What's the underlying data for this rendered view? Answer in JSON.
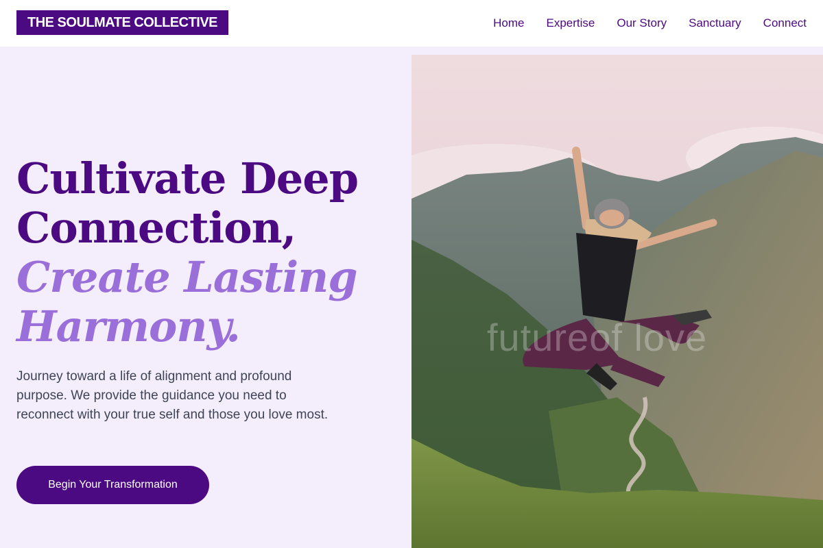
{
  "brand": {
    "name": "THE SOULMATE COLLECTIVE"
  },
  "nav": {
    "items": [
      {
        "label": "Home"
      },
      {
        "label": "Expertise"
      },
      {
        "label": "Our Story"
      },
      {
        "label": "Sanctuary"
      },
      {
        "label": "Connect"
      }
    ]
  },
  "hero": {
    "headline_line1": "Cultivate Deep",
    "headline_line2": "Connection,",
    "headline_accent_line1": "Create Lasting",
    "headline_accent_line2": "Harmony.",
    "subtext": "Journey toward a life of alignment and profound purpose. We provide the guidance you need to reconnect with your true self and those you love most.",
    "cta_label": "Begin Your Transformation",
    "image_watermark": "futureof love"
  },
  "colors": {
    "brand_purple": "#4b0a82",
    "accent_lavender": "#9b6fd9",
    "page_background": "#f4eefc",
    "body_text": "#3e4456"
  }
}
